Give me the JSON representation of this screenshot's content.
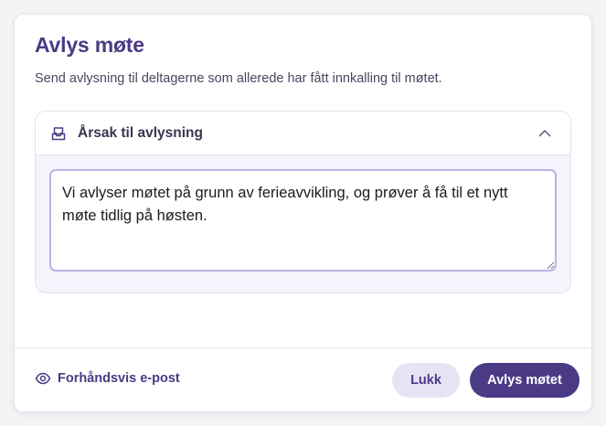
{
  "dialog": {
    "title": "Avlys møte",
    "subtitle": "Send avlysning til deltagerne som allerede har fått innkalling til møtet."
  },
  "reason_section": {
    "icon": "mail-tray-icon",
    "title": "Årsak til avlysning",
    "expanded": true,
    "toggle_icon": "chevron-up-icon",
    "message": "Vi avlyser møtet på grunn av ferieavvikling, og prøver å få til et nytt møte tidlig på høsten."
  },
  "footer": {
    "preview_icon": "eye-icon",
    "preview_label": "Forhåndsvis e-post",
    "close_label": "Lukk",
    "cancel_meeting_label": "Avlys møtet"
  },
  "colors": {
    "accent": "#4b3a85",
    "accent_light": "#e7e3f5",
    "section_bg": "#f5f3fb",
    "textarea_border": "#bdb1e6"
  }
}
